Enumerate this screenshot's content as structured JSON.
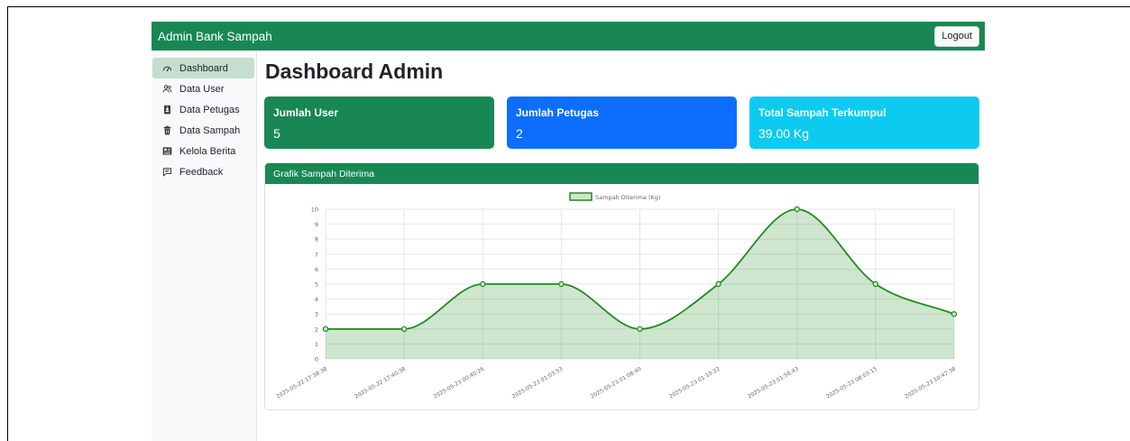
{
  "navbar": {
    "brand": "Admin Bank Sampah",
    "logout_label": "Logout"
  },
  "sidebar": {
    "items": [
      {
        "label": "Dashboard",
        "icon": "dashboard-gauge-icon",
        "active": true
      },
      {
        "label": "Data User",
        "icon": "users-icon",
        "active": false
      },
      {
        "label": "Data Petugas",
        "icon": "person-badge-icon",
        "active": false
      },
      {
        "label": "Data Sampah",
        "icon": "trash-icon",
        "active": false
      },
      {
        "label": "Kelola Berita",
        "icon": "newspaper-icon",
        "active": false
      },
      {
        "label": "Feedback",
        "icon": "chat-icon",
        "active": false
      }
    ]
  },
  "main": {
    "title": "Dashboard Admin",
    "cards": [
      {
        "title": "Jumlah User",
        "value": "5",
        "color": "#198754"
      },
      {
        "title": "Jumlah Petugas",
        "value": "2",
        "color": "#0d6efd"
      },
      {
        "title": "Total Sampah Terkumpul",
        "value": "39.00 Kg",
        "color": "#0dcaf0"
      }
    ],
    "chart_card_title": "Grafik Sampah Diterima"
  },
  "colors": {
    "primary_green": "#198754",
    "line_green": "#228b22",
    "fill_green": "rgba(34,139,34,0.22)"
  },
  "chart_data": {
    "type": "line",
    "title": "",
    "xlabel": "",
    "ylabel": "",
    "x": [
      "2025-05-22 17:38:38",
      "2025-05-22 17:40:38",
      "2025-05-23 00:40:26",
      "2025-05-23 01:03:53",
      "2025-05-23 01:08:40",
      "2025-05-23 01:10:22",
      "2025-05-23 01:56:43",
      "2025-05-23 08:03:15",
      "2025-05-23 10:47:38"
    ],
    "series": [
      {
        "name": "Sampah Diterima (Kg)",
        "values": [
          2,
          2,
          5,
          5,
          2,
          5,
          10,
          5,
          3
        ]
      }
    ],
    "ylim": [
      0,
      10
    ],
    "yticks": [
      0,
      1,
      2,
      3,
      4,
      5,
      6,
      7,
      8,
      9,
      10
    ],
    "grid": true,
    "legend": "top-center",
    "fill": true
  }
}
